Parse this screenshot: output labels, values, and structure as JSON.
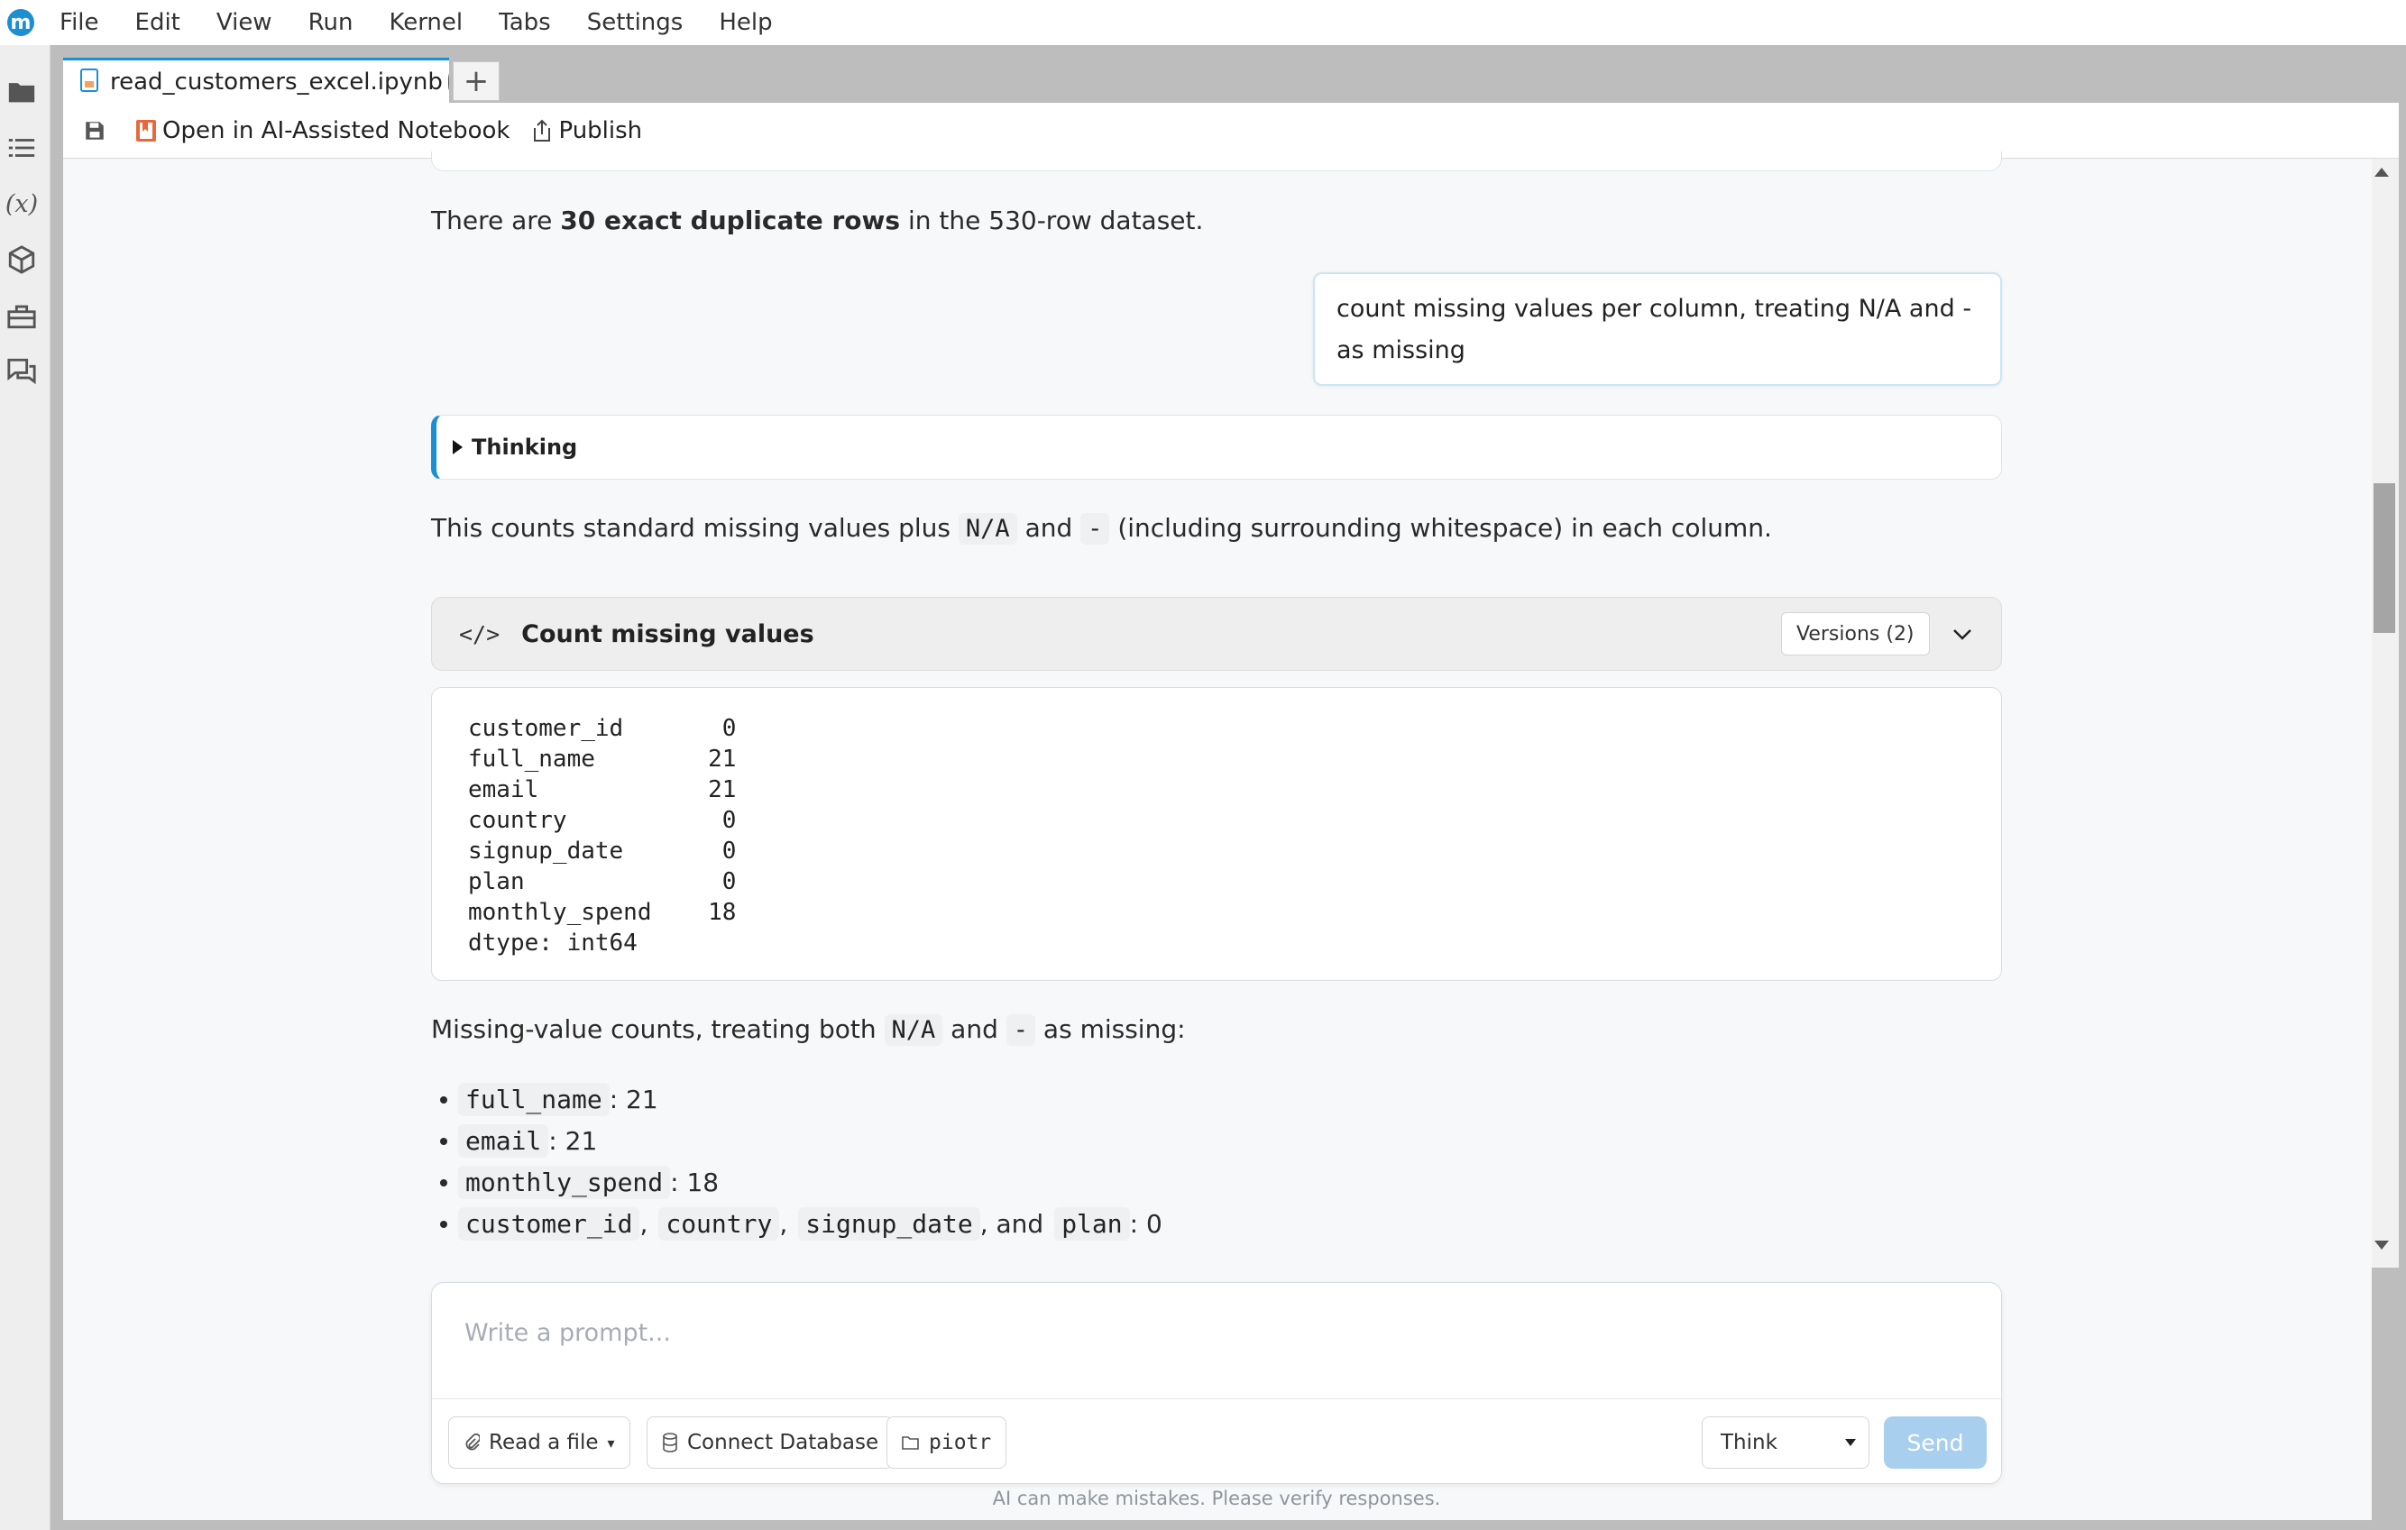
{
  "menu": {
    "logo": "m",
    "items": [
      "File",
      "Edit",
      "View",
      "Run",
      "Kernel",
      "Tabs",
      "Settings",
      "Help"
    ]
  },
  "sidebar": {
    "icons": [
      "folder-icon",
      "list-icon",
      "variables-icon",
      "package-icon",
      "toolbox-icon",
      "chat-icon"
    ],
    "variables_label": "(x)"
  },
  "tab": {
    "label": "read_customers_excel.ipynb",
    "new_tab": "+"
  },
  "toolbar": {
    "open_ai_label": "Open in AI-Assisted Notebook",
    "publish_label": "Publish"
  },
  "chat": {
    "dup_text_pre": "There are ",
    "dup_text_bold": "30 exact duplicate rows",
    "dup_text_post": " in the 530-row dataset.",
    "user_message": "count missing values per column, treating N/A and - as missing",
    "thinking_label": "Thinking",
    "intro_pre": "This counts standard missing values plus ",
    "intro_code1": "N/A",
    "intro_mid": " and ",
    "intro_code2": "-",
    "intro_post": " (including surrounding whitespace) in each column.",
    "code_block": {
      "icon": "</>",
      "title": "Count missing values",
      "versions": "Versions (2)"
    },
    "output_lines": [
      "customer_id       0",
      "full_name        21",
      "email            21",
      "country           0",
      "signup_date       0",
      "plan              0",
      "monthly_spend    18",
      "dtype: int64"
    ],
    "summary_pre": "Missing-value counts, treating both ",
    "summary_code1": "N/A",
    "summary_mid": " and ",
    "summary_code2": "-",
    "summary_post": " as missing:",
    "bullets": {
      "b1_code": "full_name",
      "b1_val": ": 21",
      "b2_code": "email",
      "b2_val": ": 21",
      "b3_code": "monthly_spend",
      "b3_val": ": 18",
      "b4_code1": "customer_id",
      "b4_code2": "country",
      "b4_code3": "signup_date",
      "b4_code4": "plan",
      "comma": ",",
      "and": ", and",
      "b4_val": ": 0"
    }
  },
  "prompt": {
    "placeholder": "Write a prompt...",
    "read_file": "Read a file",
    "read_file_caret": "▾",
    "connect_db": "Connect Database",
    "folder": "piotr",
    "mode": "Think",
    "send": "Send",
    "disclaimer": "AI can make mistakes. Please verify responses."
  },
  "colors": {
    "accent": "#1a8fd6",
    "send_disabled": "#a9cfee",
    "user_bubble_border": "#c9e6f5"
  }
}
